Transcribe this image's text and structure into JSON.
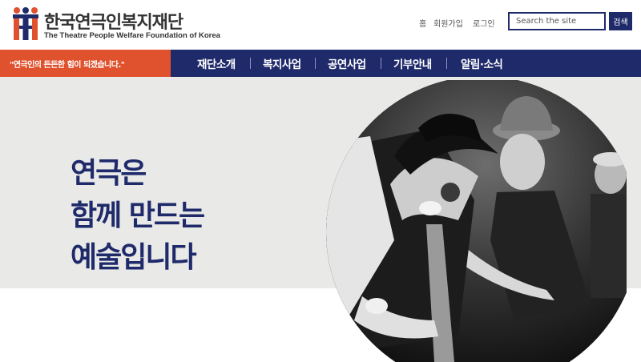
{
  "header": {
    "logo_title": "한국연극인복지재단",
    "logo_subtitle": "The Theatre People Welfare Foundation of Korea",
    "util_links": [
      "홈",
      "회원가입",
      "로그인"
    ],
    "search_placeholder": "Search the site",
    "search_button": "검색"
  },
  "nav": {
    "slogan": "\"연극인의 든든한 힘이 되겠습니다.\"",
    "items": [
      "재단소개",
      "복지사업",
      "공연사업",
      "기부안내",
      "알림·소식"
    ]
  },
  "hero": {
    "lines": [
      "연극은",
      "함께 만드는",
      "예술입니다"
    ]
  },
  "colors": {
    "navy": "#1f2a6b",
    "orange": "#e0522e",
    "hero_bg": "#e9e9e7"
  }
}
